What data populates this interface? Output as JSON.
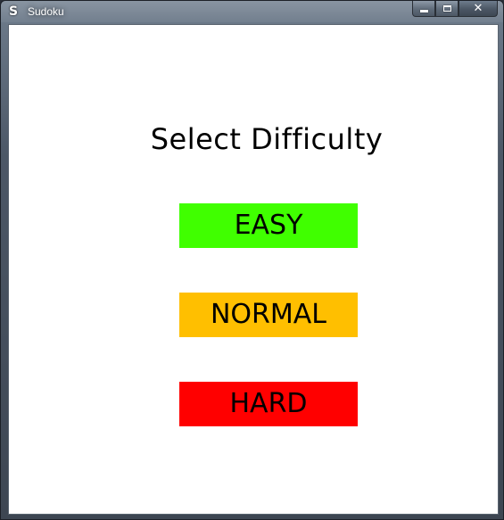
{
  "window": {
    "title": "Sudoku",
    "icon_letter": "S",
    "icon": "app-icon",
    "controls": {
      "minimize_icon": "minimize-icon",
      "maximize_icon": "maximize-icon",
      "close_glyph": "✕"
    }
  },
  "screen": {
    "heading": "Select Difficulty",
    "buttons": [
      {
        "label": "EASY",
        "color": "#40ff00"
      },
      {
        "label": "NORMAL",
        "color": "#ffbf00"
      },
      {
        "label": "HARD",
        "color": "#ff0000"
      }
    ]
  }
}
